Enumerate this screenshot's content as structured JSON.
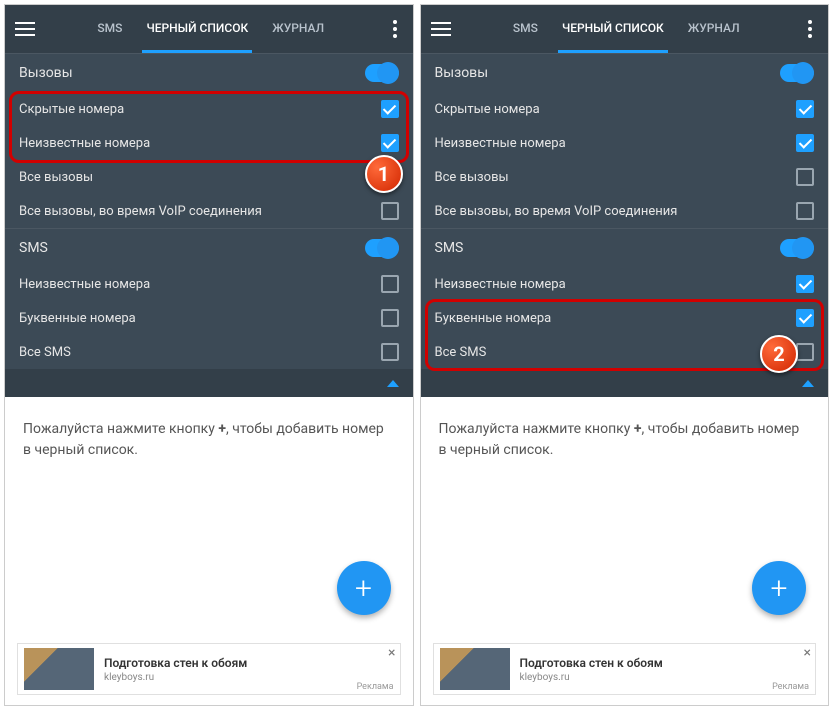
{
  "tabs": {
    "sms": "SMS",
    "blacklist": "ЧЕРНЫЙ СПИСОК",
    "log": "ЖУРНАЛ"
  },
  "sections": {
    "calls_header": "Вызовы",
    "sms_header": "SMS"
  },
  "rows": {
    "hidden": "Скрытые номера",
    "unknown_calls": "Неизвестные номера",
    "all_calls": "Все вызовы",
    "voip": "Все вызовы, во время VoIP соединения",
    "unknown_sms": "Неизвестные номера",
    "alpha": "Буквенные номера",
    "all_sms": "Все SMS"
  },
  "prompt": {
    "pre": "Пожалуйста нажмите кнопку ",
    "plus": "+",
    "post": ", чтобы добавить номер в черный список."
  },
  "ad": {
    "title": "Подготовка стен к обоям",
    "source": "kleyboys.ru",
    "label": "Реклама"
  },
  "callouts": {
    "one": "1",
    "two": "2"
  }
}
